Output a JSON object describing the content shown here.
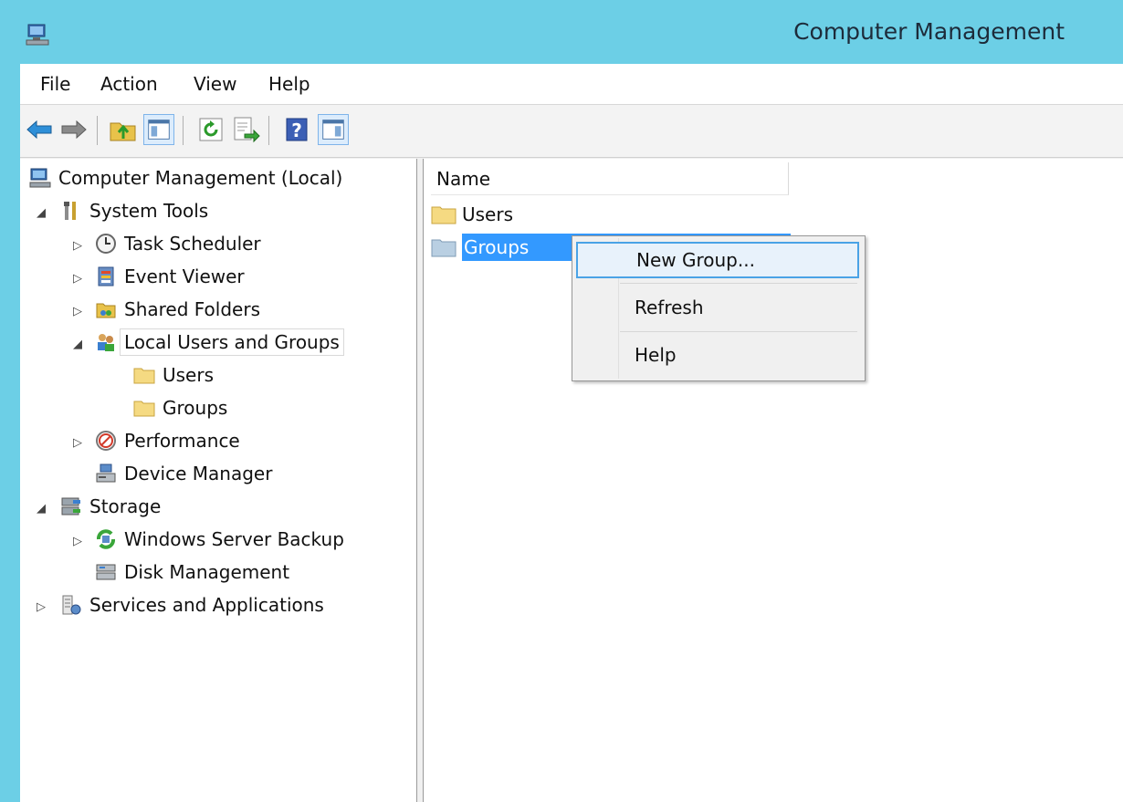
{
  "window": {
    "title": "Computer Management"
  },
  "menu": [
    "File",
    "Action",
    "View",
    "Help"
  ],
  "toolbar": {
    "buttons": [
      "back-icon",
      "forward-icon",
      "up-folder-icon",
      "show-hide-tree-icon",
      "refresh-icon",
      "export-list-icon",
      "help-icon",
      "show-hide-action-pane-icon"
    ]
  },
  "tree": {
    "root": "Computer Management (Local)",
    "system_tools": "System Tools",
    "task_scheduler": "Task Scheduler",
    "event_viewer": "Event Viewer",
    "shared_folders": "Shared Folders",
    "local_users_groups": "Local Users and Groups",
    "users": "Users",
    "groups": "Groups",
    "performance": "Performance",
    "device_manager": "Device Manager",
    "storage": "Storage",
    "windows_server_backup": "Windows Server Backup",
    "disk_management": "Disk Management",
    "services_applications": "Services and Applications"
  },
  "list": {
    "column_name": "Name",
    "items": [
      "Users",
      "Groups"
    ],
    "selected": "Groups"
  },
  "context_menu": {
    "items": [
      "New Group...",
      "Refresh",
      "Help"
    ],
    "hot_item": "New Group..."
  },
  "colors": {
    "titlebar": "#6ccfe6",
    "selection": "#3399ff",
    "menu_hot_border": "#4aa3e6"
  }
}
